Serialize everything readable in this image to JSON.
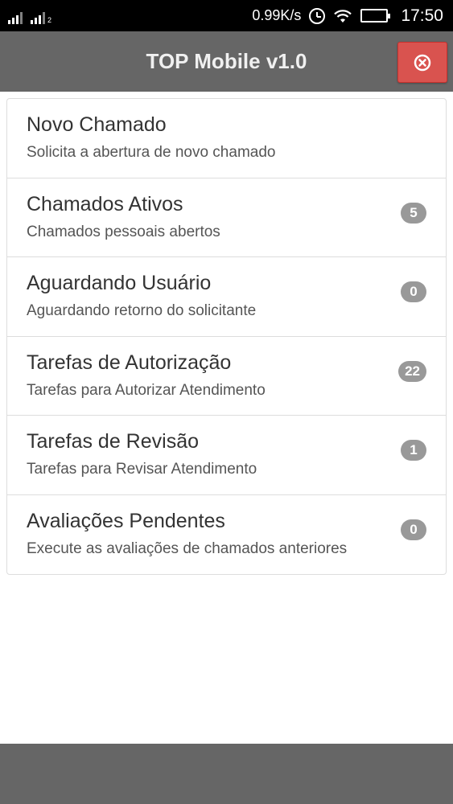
{
  "status_bar": {
    "speed": "0.99K/s",
    "time": "17:50",
    "sim2_label": "2"
  },
  "header": {
    "title": "TOP Mobile v1.0"
  },
  "colors": {
    "header_bg": "#666666",
    "close_button_bg": "#d9534f",
    "badge_bg": "#999999"
  },
  "menu": {
    "items": [
      {
        "title": "Novo Chamado",
        "subtitle": "Solicita a abertura de novo chamado"
      },
      {
        "title": "Chamados Ativos",
        "subtitle": "Chamados pessoais abertos",
        "badge": "5"
      },
      {
        "title": "Aguardando Usuário",
        "subtitle": "Aguardando retorno do solicitante",
        "badge": "0"
      },
      {
        "title": "Tarefas de Autorização",
        "subtitle": "Tarefas para Autorizar Atendimento",
        "badge": "22"
      },
      {
        "title": "Tarefas de Revisão",
        "subtitle": "Tarefas para Revisar Atendimento",
        "badge": "1"
      },
      {
        "title": "Avaliações Pendentes",
        "subtitle": "Execute as avaliações de chamados anteriores",
        "badge": "0"
      }
    ]
  }
}
